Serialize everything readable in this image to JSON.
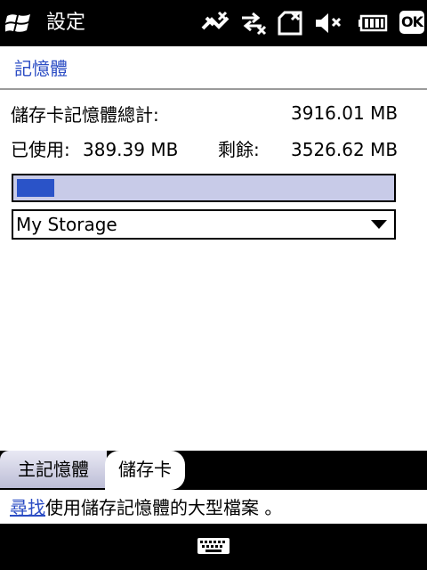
{
  "titlebar": {
    "title": "設定",
    "ok_label": "OK",
    "icons": [
      "windows-start-flag",
      "phone-off-icon",
      "data-connection-icon",
      "no-sim-icon",
      "volume-mute-icon",
      "battery-icon"
    ]
  },
  "page": {
    "header": "記憶體"
  },
  "storage": {
    "total_label": "儲存卡記憶體總計:",
    "total_value": "3916.01 MB",
    "used_label": "已使用:",
    "used_value": "389.39 MB",
    "free_label": "剩餘:",
    "free_value": "3526.62 MB",
    "used_fraction": 0.099,
    "selected_storage": "My Storage"
  },
  "tabs": [
    {
      "label": "主記憶體",
      "active": false
    },
    {
      "label": "儲存卡",
      "active": true
    }
  ],
  "footer": {
    "link_text": "尋找",
    "rest_text": "使用儲存記憶體的大型檔案 。"
  },
  "softbar": {
    "icon": "keyboard-icon"
  },
  "colors": {
    "accent": "#2b4cc4",
    "progress_fill": "#2a53c8",
    "progress_track": "#c8cbe8"
  }
}
